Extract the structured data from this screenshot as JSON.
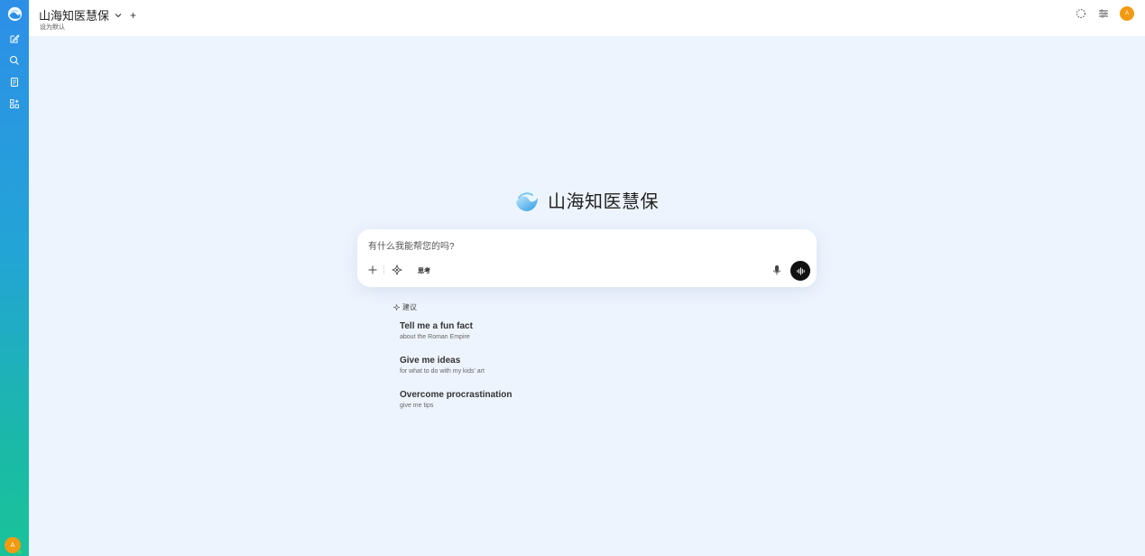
{
  "app": {
    "model_name": "山海知医慧保",
    "set_default_label": "设为默认",
    "avatar_initial": "A"
  },
  "brand": {
    "title": "山海知医慧保"
  },
  "composer": {
    "placeholder": "有什么我能帮您的吗?",
    "think_label": "思考"
  },
  "suggestions": {
    "header": "建议",
    "items": [
      {
        "title": "Tell me a fun fact",
        "subtitle": "about the Roman Empire"
      },
      {
        "title": "Give me ideas",
        "subtitle": "for what to do with my kids' art"
      },
      {
        "title": "Overcome procrastination",
        "subtitle": "give me tips"
      }
    ]
  },
  "sidebar": {
    "items": [
      {
        "icon": "new-chat-icon"
      },
      {
        "icon": "search-icon"
      },
      {
        "icon": "notes-icon"
      },
      {
        "icon": "workspace-icon"
      }
    ]
  },
  "colors": {
    "sidebar_top": "#2d8fe8",
    "sidebar_bottom": "#19c39a",
    "avatar": "#f29a12",
    "background": "#eef4fe"
  }
}
